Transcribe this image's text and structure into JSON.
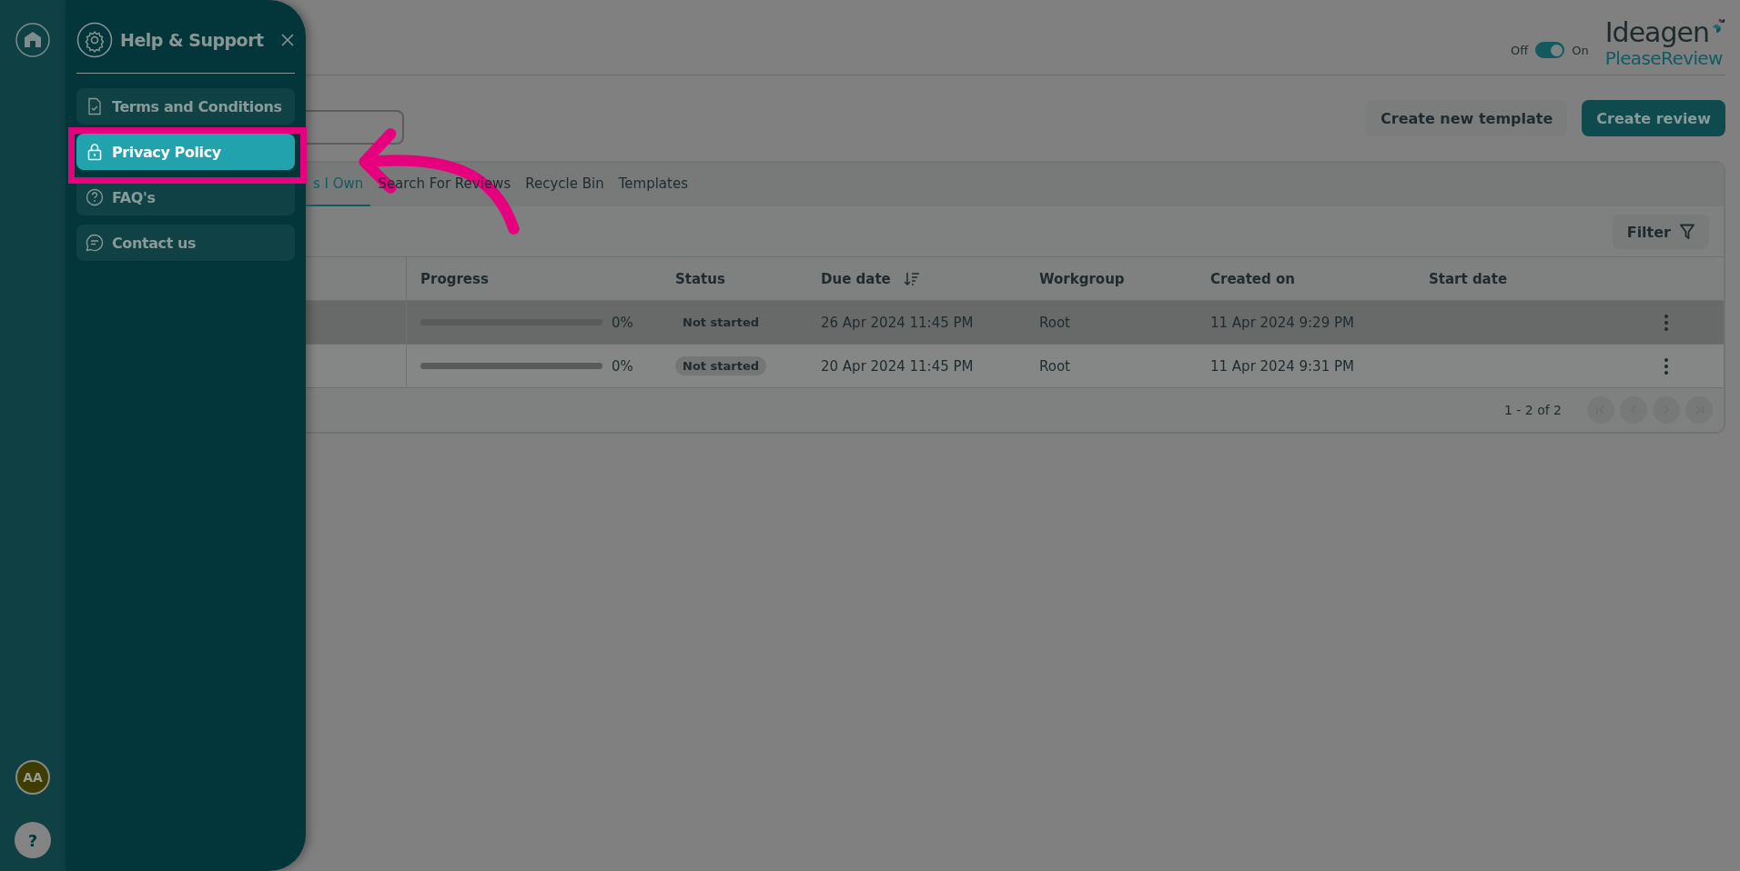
{
  "rail": {
    "avatar": "AA",
    "help": "?"
  },
  "panel": {
    "title": "Help & Support",
    "items": [
      {
        "label": "Terms and Conditions",
        "selected": false
      },
      {
        "label": "Privacy Policy",
        "selected": true
      },
      {
        "label": "FAQ's",
        "selected": false
      },
      {
        "label": "Contact us",
        "selected": false
      }
    ]
  },
  "header": {
    "toggle": {
      "off_label": "Off",
      "on_label": "On",
      "on": true
    },
    "logo": {
      "brand": "Ideagen",
      "product": "PleaseReview"
    }
  },
  "actions": [
    "Create new template",
    "Create review"
  ],
  "tabs": [
    {
      "label": "s I Own",
      "selected": true
    },
    {
      "label": "Search For Reviews",
      "selected": false
    },
    {
      "label": "Recycle Bin",
      "selected": false
    },
    {
      "label": "Templates",
      "selected": false
    }
  ],
  "filter": "Filter",
  "table": {
    "columns": [
      "Progress",
      "Status",
      "Due date",
      "Workgroup",
      "Created on",
      "Start date"
    ],
    "rows": [
      {
        "level": 0,
        "percent": "0%",
        "status": "Not started",
        "due": "26 Apr 2024 11:45 PM",
        "workgroup": "Root",
        "created": "11 Apr 2024 9:29 PM",
        "selected": true
      },
      {
        "level": 0,
        "percent": "0%",
        "status": "Not started",
        "due": "20 Apr 2024 11:45 PM",
        "workgroup": "Root",
        "created": "11 Apr 2024 9:31 PM",
        "selected": false
      }
    ]
  },
  "pagination": {
    "range": "1 - 2 of 2"
  }
}
